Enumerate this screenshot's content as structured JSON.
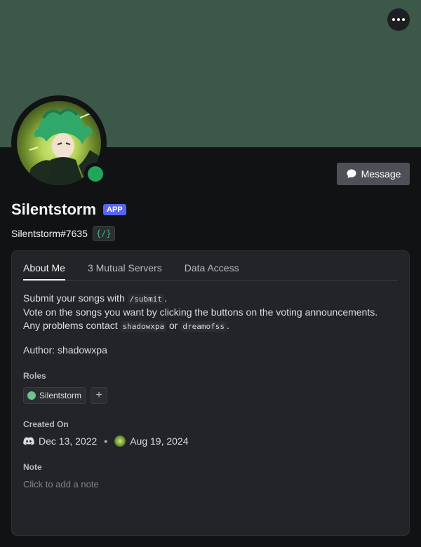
{
  "header": {
    "more_icon": "more-horizontal-icon"
  },
  "profile": {
    "display_name": "Silentstorm",
    "app_badge": "APP",
    "username": "Silentstorm#7635",
    "slash_badge": "{/}",
    "status": "online",
    "status_color": "#23a55a",
    "banner_color": "#3c5848",
    "message_button": "Message"
  },
  "tabs": [
    {
      "label": "About Me",
      "active": true
    },
    {
      "label": "3 Mutual Servers",
      "active": false
    },
    {
      "label": "Data Access",
      "active": false
    }
  ],
  "about": {
    "line1_pre": "Submit your songs with",
    "line1_code": "/submit",
    "line1_post": ".",
    "line2": "Vote on the songs you want by clicking the buttons on the voting announcements.",
    "line3_pre": "Any problems contact",
    "line3_code1": "shadowxpa",
    "line3_mid": "or",
    "line3_code2": "dreamofss",
    "line3_post": ".",
    "author": "Author: shadowxpa"
  },
  "roles": {
    "title": "Roles",
    "items": [
      {
        "name": "Silentstorm",
        "color": "#6bc48f"
      }
    ],
    "add_label": "+"
  },
  "created": {
    "title": "Created On",
    "discord_date": "Dec 13, 2022",
    "separator": "•",
    "server_date": "Aug 19, 2024"
  },
  "note": {
    "title": "Note",
    "placeholder": "Click to add a note"
  }
}
